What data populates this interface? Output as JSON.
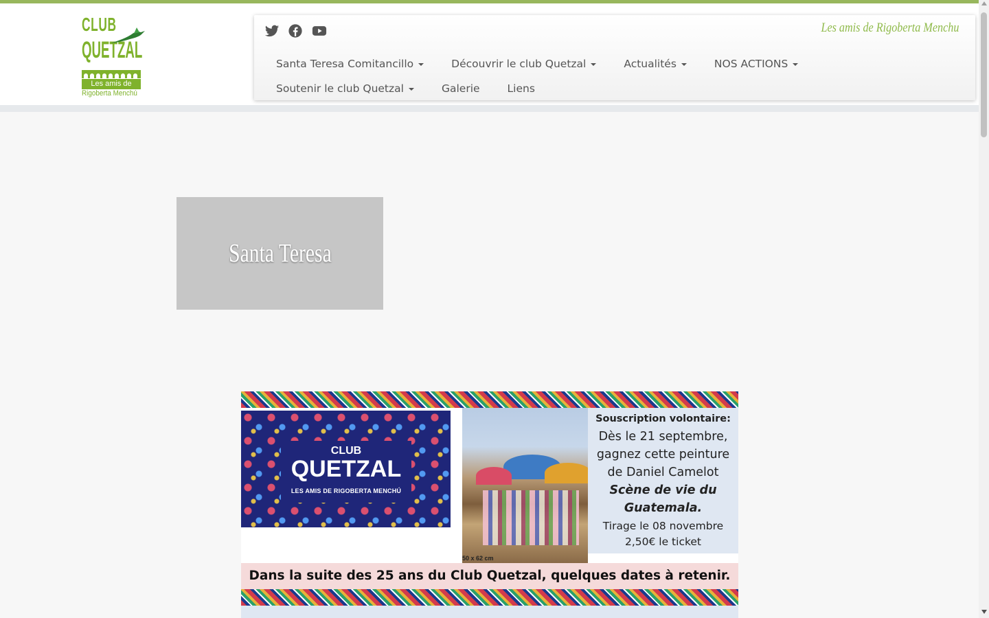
{
  "brand": {
    "logo_line1": "CLUB",
    "logo_line2": "QUETZAL",
    "logo_sub1": "Les amis de",
    "logo_sub2": "Rigoberta Menchú",
    "tagline": "Les amis de Rigoberta Menchu",
    "accent_color": "#98b75d",
    "logo_green": "#7fb22c"
  },
  "social": {
    "icons": [
      "twitter-icon",
      "facebook-icon",
      "youtube-icon"
    ]
  },
  "nav": {
    "row1": [
      {
        "label": "Santa Teresa Comitancillo",
        "has_dropdown": true
      },
      {
        "label": "Découvrir le club Quetzal",
        "has_dropdown": true
      },
      {
        "label": "Actualités",
        "has_dropdown": true
      },
      {
        "label": "NOS ACTIONS",
        "has_dropdown": true
      }
    ],
    "row2": [
      {
        "label": "Soutenir le club Quetzal",
        "has_dropdown": true
      },
      {
        "label": "Galerie",
        "has_dropdown": false
      },
      {
        "label": "Liens",
        "has_dropdown": false
      }
    ]
  },
  "feature": {
    "title": "Santa Teresa"
  },
  "banner": {
    "logo_club": "CLUB",
    "logo_quetzal": "QUETZAL",
    "logo_sub": "LES AMIS DE RIGOBERTA MENCHÚ",
    "painting_caption": "50 x 62 cm",
    "info": {
      "line1": "Souscription  volontaire:",
      "line2": "Dès le 21 septembre,",
      "line3": "gagnez cette peinture",
      "line4": "de Daniel Camelot",
      "line5": "Scène de vie du",
      "line6": "Guatemala.",
      "line7": "Tirage le 08 novembre",
      "line8": "2,50€ le ticket"
    },
    "dates_text": "Dans la suite  des 25 ans du Club Quetzal, quelques dates à retenir."
  }
}
